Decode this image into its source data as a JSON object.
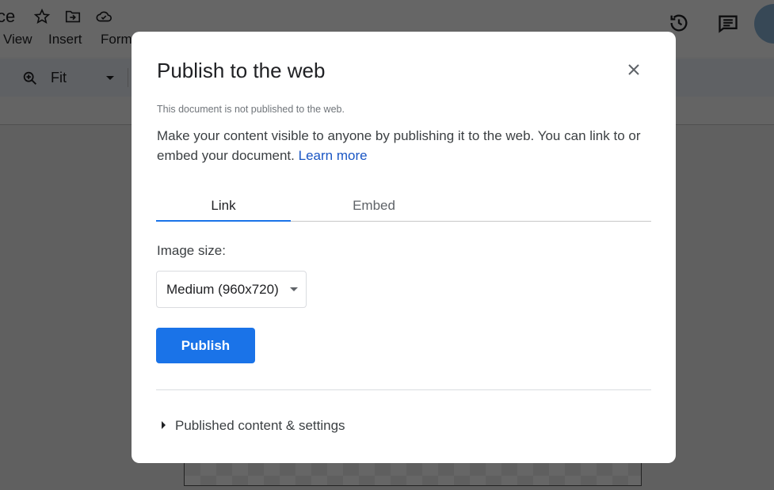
{
  "app": {
    "title_fragment": "ce",
    "menu": [
      "View",
      "Insert",
      "Form"
    ],
    "zoom_value": "Fit"
  },
  "dialog": {
    "title": "Publish to the web",
    "status": "This document is not published to the web.",
    "description": "Make your content visible to anyone by publishing it to the web. You can link to or embed your document.",
    "learn_more": "Learn more",
    "tabs": [
      {
        "label": "Link",
        "active": true
      },
      {
        "label": "Embed",
        "active": false
      }
    ],
    "image_size_label": "Image size:",
    "image_size_value": "Medium (960x720)",
    "publish_label": "Publish",
    "expander_label": "Published content & settings"
  },
  "colors": {
    "accent": "#1a73e8",
    "link": "#1a56c4"
  }
}
